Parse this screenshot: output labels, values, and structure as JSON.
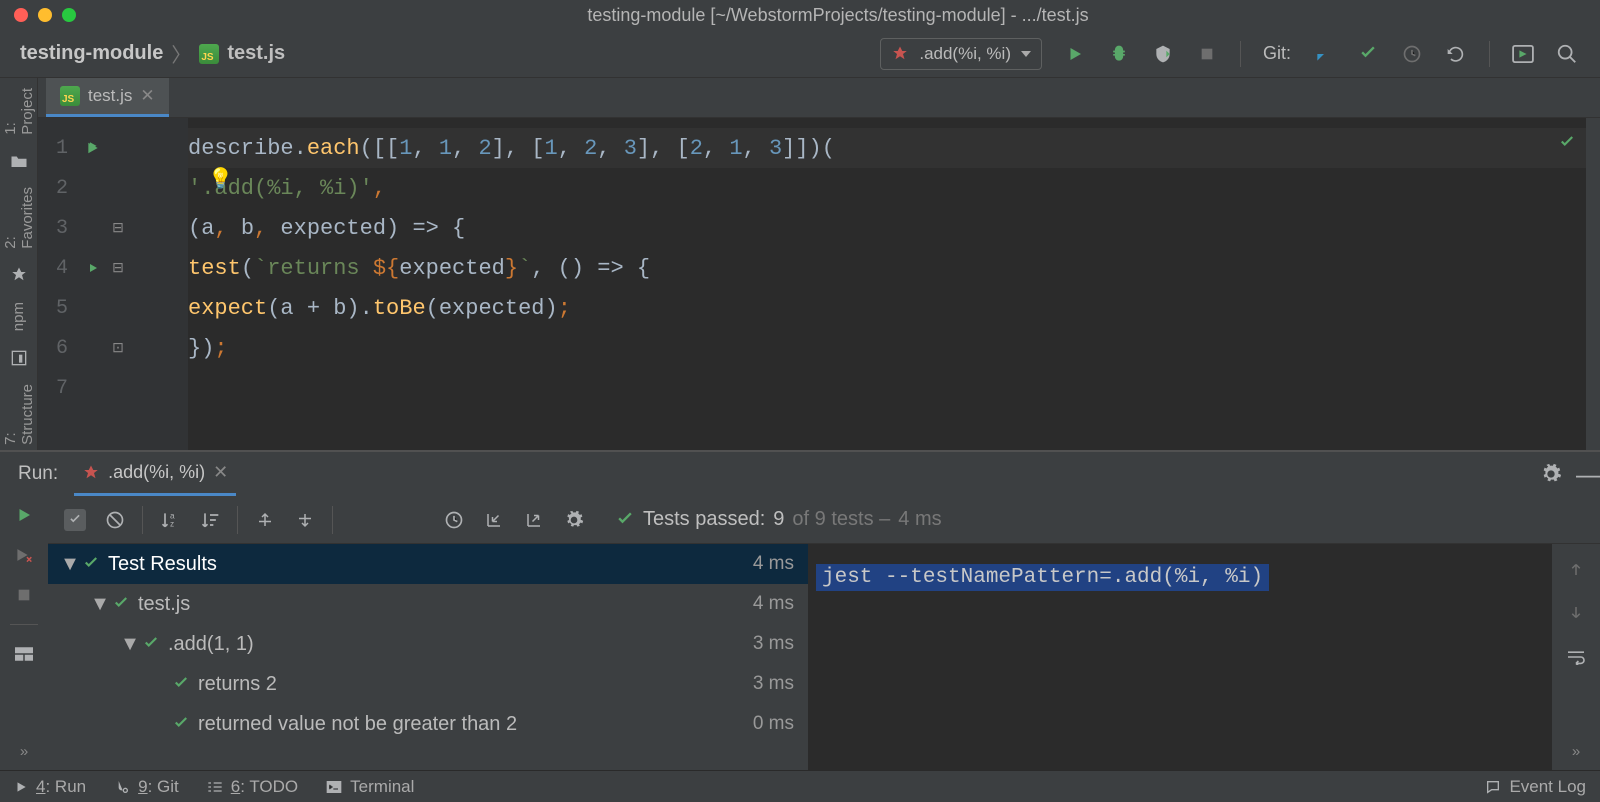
{
  "window_title": "testing-module [~/WebstormProjects/testing-module] - .../test.js",
  "breadcrumb": {
    "project": "testing-module",
    "file": "test.js"
  },
  "run_config": {
    "label": ".add(%i, %i)"
  },
  "git_label": "Git:",
  "editor_tab": {
    "file": "test.js"
  },
  "code_lines": [
    "describe.each([[1, 1, 2], [1, 2, 3], [2, 1, 3]])(",
    "    '.add(%i, %i)',",
    "    (a, b, expected) => {",
    "        test(`returns ${expected}`, () => {",
    "            expect(a + b).toBe(expected);",
    "        });",
    ""
  ],
  "left_rail": {
    "project": "1: Project",
    "favorites": "2: Favorites",
    "npm": "npm",
    "structure": "7: Structure"
  },
  "run_panel": {
    "title": "Run:",
    "tab": ".add(%i, %i)",
    "status_prefix": "Tests passed:",
    "status_passed": "9",
    "status_mid": "of 9 tests –",
    "status_time": "4 ms",
    "tree": [
      {
        "name": "Test Results",
        "time": "4 ms",
        "indent": 0,
        "expanded": true,
        "selected": true
      },
      {
        "name": "test.js",
        "time": "4 ms",
        "indent": 1,
        "expanded": true
      },
      {
        "name": ".add(1, 1)",
        "time": "3 ms",
        "indent": 2,
        "expanded": true
      },
      {
        "name": "returns 2",
        "time": "3 ms",
        "indent": 3
      },
      {
        "name": "returned value not be greater than 2",
        "time": "0 ms",
        "indent": 3
      }
    ],
    "console": "jest --testNamePattern=.add(%i, %i)"
  },
  "bottom": {
    "run": "4: Run",
    "git": "9: Git",
    "todo": "6: TODO",
    "terminal": "Terminal",
    "event_log": "Event Log"
  }
}
